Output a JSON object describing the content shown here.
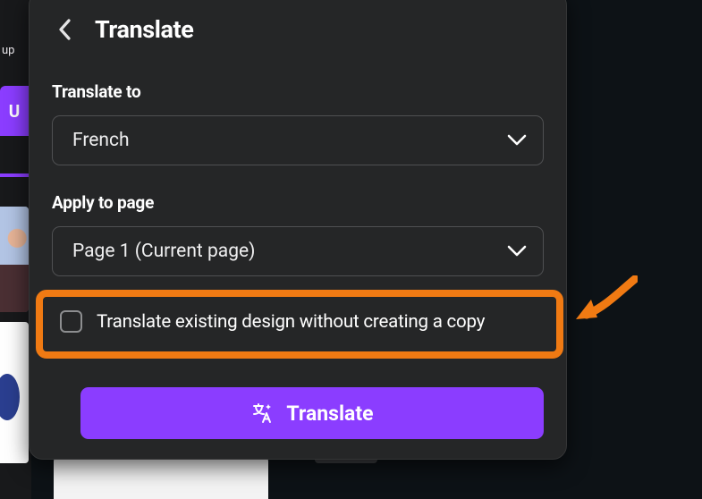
{
  "panel": {
    "title": "Translate",
    "translate_to_label": "Translate to",
    "translate_to_value": "French",
    "apply_to_label": "Apply to page",
    "apply_to_value": "Page 1 (Current page)",
    "checkbox_label": "Translate existing design without creating a copy",
    "button_label": "Translate"
  },
  "left_stub": {
    "text": "up",
    "purple_initial": "U"
  },
  "colors": {
    "accent": "#8b3dff",
    "highlight": "#f07a13",
    "panel_bg": "#252627"
  }
}
